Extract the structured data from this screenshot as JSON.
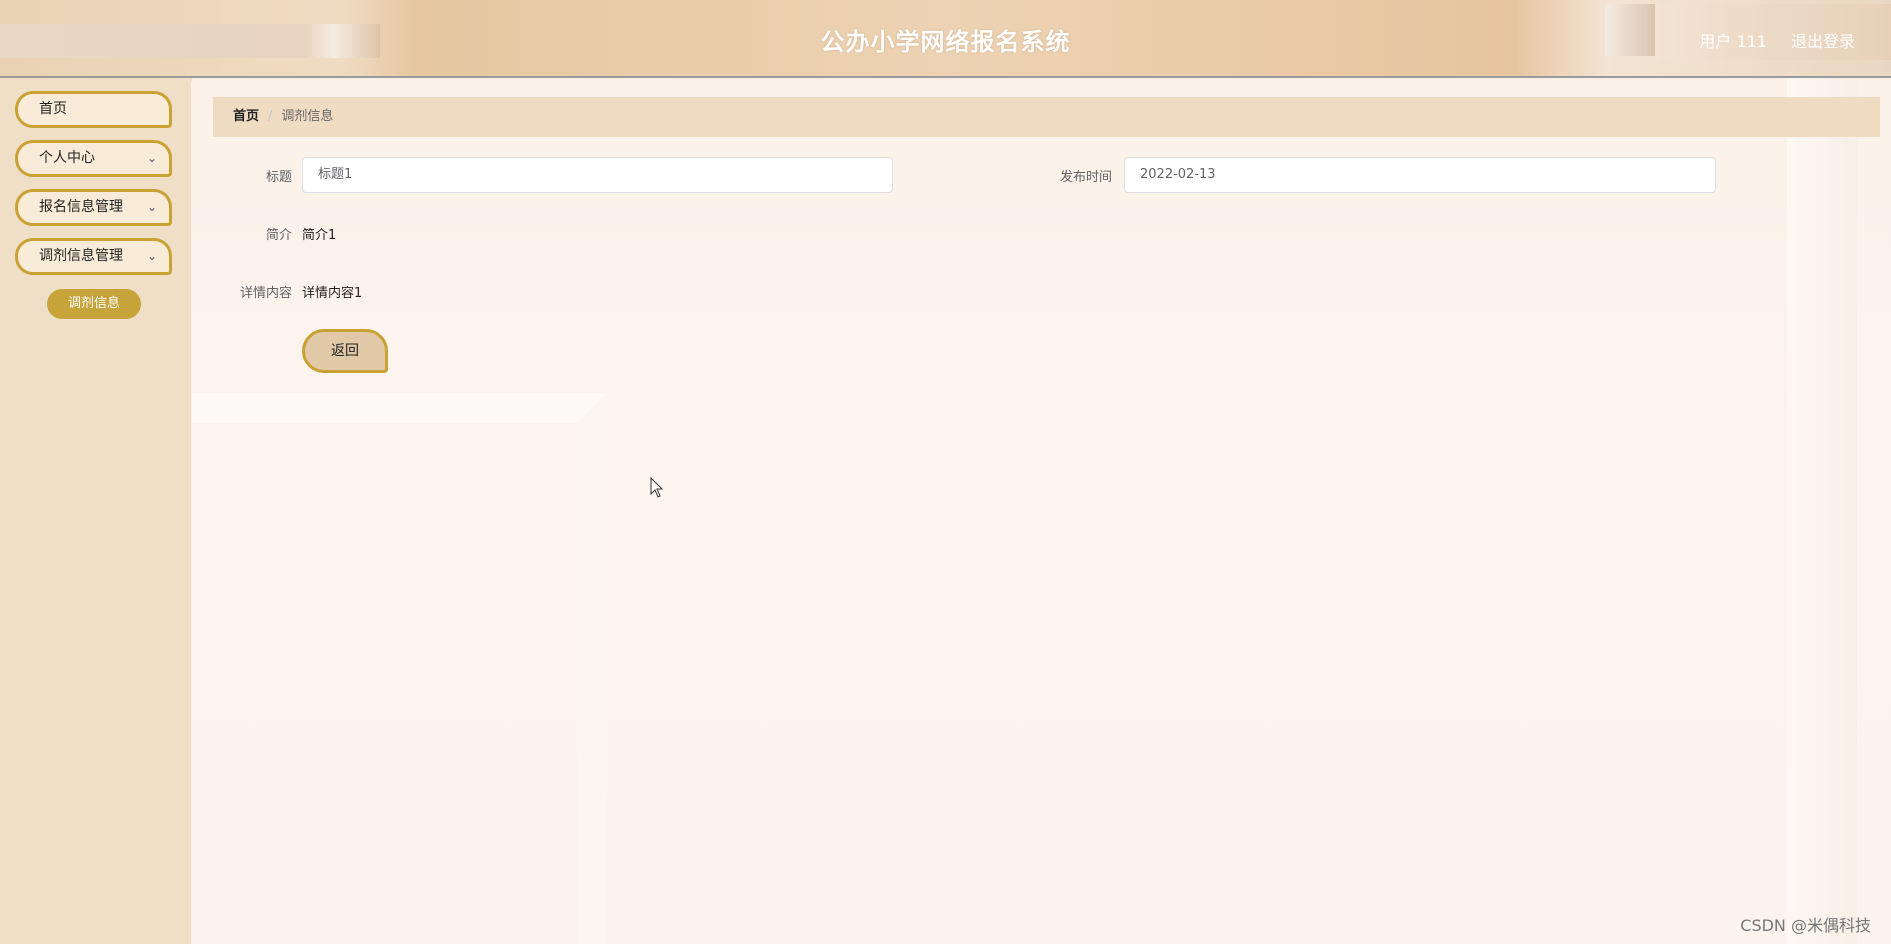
{
  "header": {
    "title": "公办小学网络报名系统",
    "user_label": "用户 111",
    "logout_label": "退出登录"
  },
  "sidebar": {
    "items": [
      {
        "label": "首页",
        "expandable": false
      },
      {
        "label": "个人中心",
        "expandable": true
      },
      {
        "label": "报名信息管理",
        "expandable": true
      },
      {
        "label": "调剂信息管理",
        "expandable": true
      }
    ],
    "sub_item": "调剂信息",
    "chevron": "⌄"
  },
  "breadcrumb": {
    "home": "首页",
    "separator": "/",
    "current": "调剂信息"
  },
  "form": {
    "title_label": "标题",
    "title_value": "标题1",
    "publish_time_label": "发布时间",
    "publish_time_value": "2022-02-13",
    "summary_label": "简介",
    "summary_value": "简介1",
    "detail_label": "详情内容",
    "detail_value": "详情内容1",
    "back_button": "返回"
  },
  "watermark": "CSDN @米偶科技",
  "colors": {
    "accent": "#c9a233",
    "sidebar_bg": "#f0dfc7",
    "breadcrumb_bg": "#efdcc3"
  }
}
